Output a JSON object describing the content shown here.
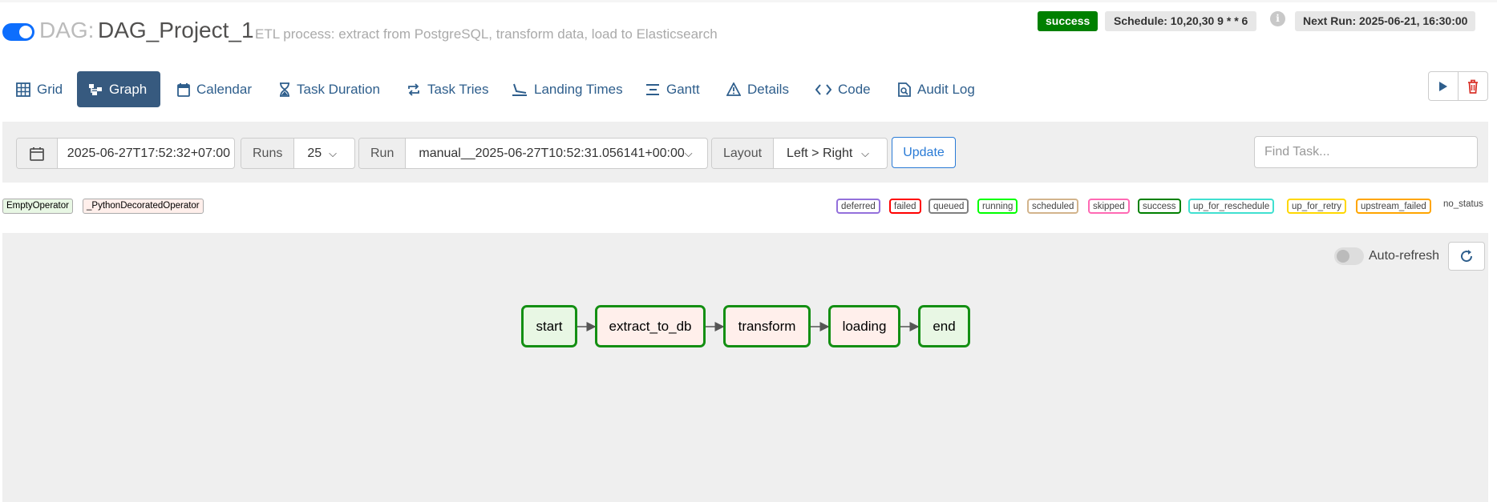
{
  "dag": {
    "prefix": "DAG:",
    "name": "DAG_Project_1",
    "description": "ETL process: extract from PostgreSQL, transform data, load to Elasticsearch",
    "state": "success",
    "schedule": "Schedule: 10,20,30 9 * * 6",
    "next_run": "Next Run: 2025-06-21, 16:30:00",
    "paused": false
  },
  "nav": {
    "tabs": [
      {
        "label": "Grid",
        "icon": "grid-icon",
        "active": false
      },
      {
        "label": "Graph",
        "icon": "graph-icon",
        "active": true
      },
      {
        "label": "Calendar",
        "icon": "calendar-icon",
        "active": false
      },
      {
        "label": "Task Duration",
        "icon": "hourglass-icon",
        "active": false
      },
      {
        "label": "Task Tries",
        "icon": "retry-icon",
        "active": false
      },
      {
        "label": "Landing Times",
        "icon": "landing-icon",
        "active": false
      },
      {
        "label": "Gantt",
        "icon": "gantt-icon",
        "active": false
      },
      {
        "label": "Details",
        "icon": "warning-icon",
        "active": false
      },
      {
        "label": "Code",
        "icon": "code-icon",
        "active": false
      },
      {
        "label": "Audit Log",
        "icon": "audit-log-icon",
        "active": false
      }
    ]
  },
  "filters": {
    "base_date": "2025-06-27T17:52:32+07:00",
    "runs_label": "Runs",
    "runs_value": "25",
    "run_label": "Run",
    "run_value": "manual__2025-06-27T10:52:31.056141+00:00",
    "layout_label": "Layout",
    "layout_value": "Left > Right",
    "update_label": "Update",
    "find_placeholder": "Find Task..."
  },
  "operators": [
    {
      "label": "EmptyOperator",
      "color": "#e8f7e4"
    },
    {
      "label": "_PythonDecoratedOperator",
      "color": "#ffefeb"
    }
  ],
  "statuses": [
    {
      "label": "deferred",
      "color": "#9370db"
    },
    {
      "label": "failed",
      "color": "#ff0000"
    },
    {
      "label": "queued",
      "color": "#808080"
    },
    {
      "label": "running",
      "color": "#00ff00"
    },
    {
      "label": "scheduled",
      "color": "#d2b48c"
    },
    {
      "label": "skipped",
      "color": "#ff69b4"
    },
    {
      "label": "success",
      "color": "#008000"
    },
    {
      "label": "up_for_reschedule",
      "color": "#40e0d0"
    },
    {
      "label": "up_for_retry",
      "color": "#ffd700"
    },
    {
      "label": "upstream_failed",
      "color": "#ffa500"
    },
    {
      "label": "no_status",
      "color": ""
    }
  ],
  "graph": {
    "autorefresh_label": "Auto-refresh",
    "tasks": [
      {
        "label": "start",
        "operator": "EmptyOperator",
        "fill": "#e8f7e4"
      },
      {
        "label": "extract_to_db",
        "operator": "_PythonDecoratedOperator",
        "fill": "#ffefeb"
      },
      {
        "label": "transform",
        "operator": "_PythonDecoratedOperator",
        "fill": "#ffefeb"
      },
      {
        "label": "loading",
        "operator": "_PythonDecoratedOperator",
        "fill": "#ffefeb"
      },
      {
        "label": "end",
        "operator": "EmptyOperator",
        "fill": "#e8f7e4"
      }
    ]
  }
}
